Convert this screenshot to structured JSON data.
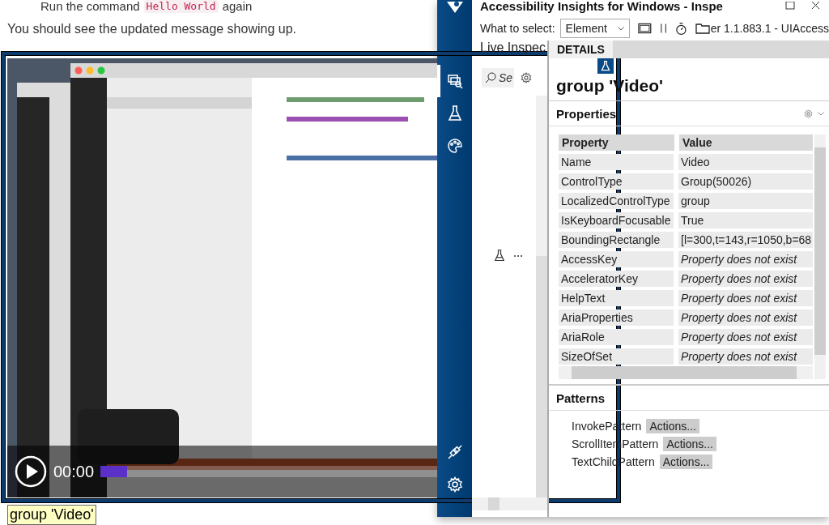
{
  "document": {
    "step": {
      "before": "Run the command",
      "code": "Hello World",
      "after": "again"
    },
    "paragraph": "You should see the updated message showing up."
  },
  "video": {
    "kind": "picture",
    "time": "00:00",
    "progress": {
      "level": 0.08
    }
  },
  "highlight_label": "group 'Video'",
  "inspector": {
    "title": "Accessibility Insights for Windows - Inspe",
    "nav": {
      "top": [
        {
          "kind": "inspect",
          "selected": true
        },
        {
          "kind": "test",
          "selected": false
        },
        {
          "kind": "color",
          "selected": false
        }
      ],
      "bottom": [
        {
          "kind": "connect",
          "selected": false
        },
        {
          "kind": "settings",
          "selected": false
        }
      ]
    },
    "toolbar": {
      "select_label": "What to select:",
      "select_value": "Element",
      "version": "er 1.1.883.1 - UIAccess"
    },
    "live_inspect": {
      "title": "Live Inspec",
      "search_placeholder": "Se"
    },
    "details_tab": "DETAILS",
    "element_title": "group 'Video'",
    "properties": {
      "title": "Properties",
      "columns": [
        "Property",
        "Value"
      ],
      "rows": [
        {
          "name": "Name",
          "value": "Video",
          "missing": false
        },
        {
          "name": "ControlType",
          "value": "Group(50026)",
          "missing": false
        },
        {
          "name": "LocalizedControlType",
          "value": "group",
          "missing": false
        },
        {
          "name": "IsKeyboardFocusable",
          "value": "True",
          "missing": false
        },
        {
          "name": "BoundingRectangle",
          "value": "[l=300,t=143,r=1050,b=68",
          "missing": false
        },
        {
          "name": "AccessKey",
          "value": "Property does not exist",
          "missing": true
        },
        {
          "name": "AcceleratorKey",
          "value": "Property does not exist",
          "missing": true
        },
        {
          "name": "HelpText",
          "value": "Property does not exist",
          "missing": true
        },
        {
          "name": "AriaProperties",
          "value": "Property does not exist",
          "missing": true
        },
        {
          "name": "AriaRole",
          "value": "Property does not exist",
          "missing": true
        },
        {
          "name": "SizeOfSet",
          "value": "Property does not exist",
          "missing": true
        }
      ]
    },
    "patterns": {
      "title": "Patterns",
      "items": [
        {
          "name": "InvokePattern",
          "action": "Actions..."
        },
        {
          "name": "ScrollItemPattern",
          "action": "Actions..."
        },
        {
          "name": "TextChildPattern",
          "action": "Actions..."
        }
      ]
    }
  }
}
